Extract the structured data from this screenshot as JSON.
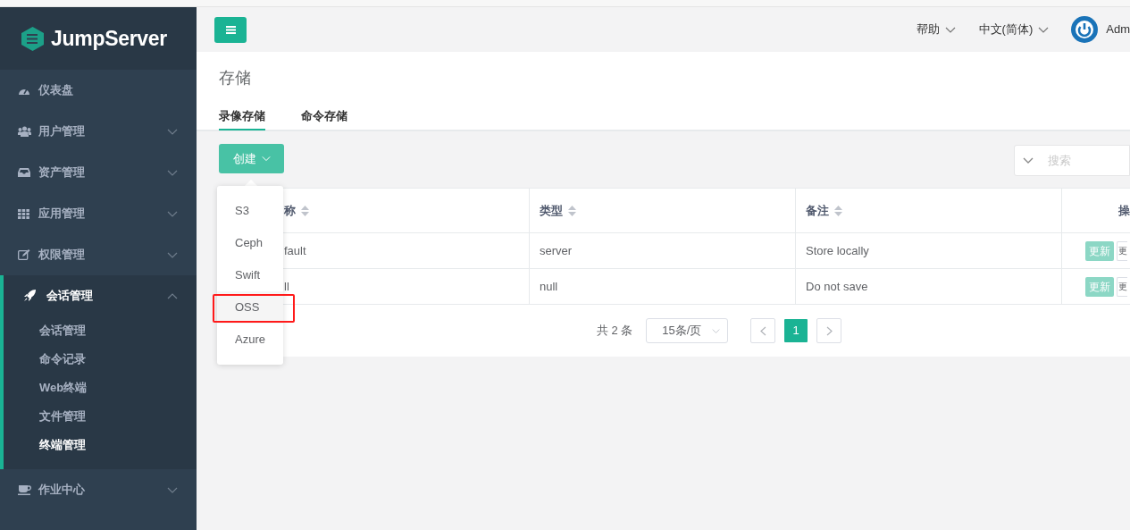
{
  "brand": {
    "name": "JumpServer"
  },
  "sidebar": {
    "items": [
      {
        "label": "仪表盘",
        "kind": "link",
        "expanded": false
      },
      {
        "label": "用户管理",
        "kind": "group",
        "expanded": false
      },
      {
        "label": "资产管理",
        "kind": "group",
        "expanded": false
      },
      {
        "label": "应用管理",
        "kind": "group",
        "expanded": false
      },
      {
        "label": "权限管理",
        "kind": "group",
        "expanded": false
      },
      {
        "label": "会话管理",
        "kind": "group",
        "expanded": true,
        "children": [
          {
            "label": "会话管理",
            "selected": false
          },
          {
            "label": "命令记录",
            "selected": false
          },
          {
            "label": "Web终端",
            "selected": false
          },
          {
            "label": "文件管理",
            "selected": false
          },
          {
            "label": "终端管理",
            "selected": true
          }
        ]
      },
      {
        "label": "作业中心",
        "kind": "group",
        "expanded": false
      }
    ]
  },
  "top_nav": {
    "help": "帮助",
    "language": "中文(简体)",
    "user": "Adm"
  },
  "page_title": "存储",
  "tabs": [
    {
      "label": "录像存储",
      "selected": true
    },
    {
      "label": "命令存储",
      "selected": false
    }
  ],
  "create_button": "创建",
  "create_menu": [
    {
      "label": "S3",
      "highlighted": false,
      "outlined": false
    },
    {
      "label": "Ceph",
      "highlighted": false,
      "outlined": false
    },
    {
      "label": "Swift",
      "highlighted": false,
      "outlined": false
    },
    {
      "label": "OSS",
      "highlighted": true,
      "outlined": true
    },
    {
      "label": "Azure",
      "highlighted": false,
      "outlined": false
    }
  ],
  "search": {
    "placeholder": "搜索"
  },
  "table": {
    "columns": [
      "称",
      "类型",
      "备注",
      "操"
    ],
    "rows": [
      {
        "cells": [
          "fault",
          "server",
          "Store locally"
        ],
        "actions": [
          "更新",
          "更"
        ]
      },
      {
        "cells": [
          "ll",
          "null",
          "Do not save"
        ],
        "actions": [
          "更新",
          "更"
        ]
      }
    ]
  },
  "pagination": {
    "total": "共 2 条",
    "page_size": "15条/页",
    "pages": [
      {
        "label": "1",
        "selected": true
      }
    ]
  }
}
